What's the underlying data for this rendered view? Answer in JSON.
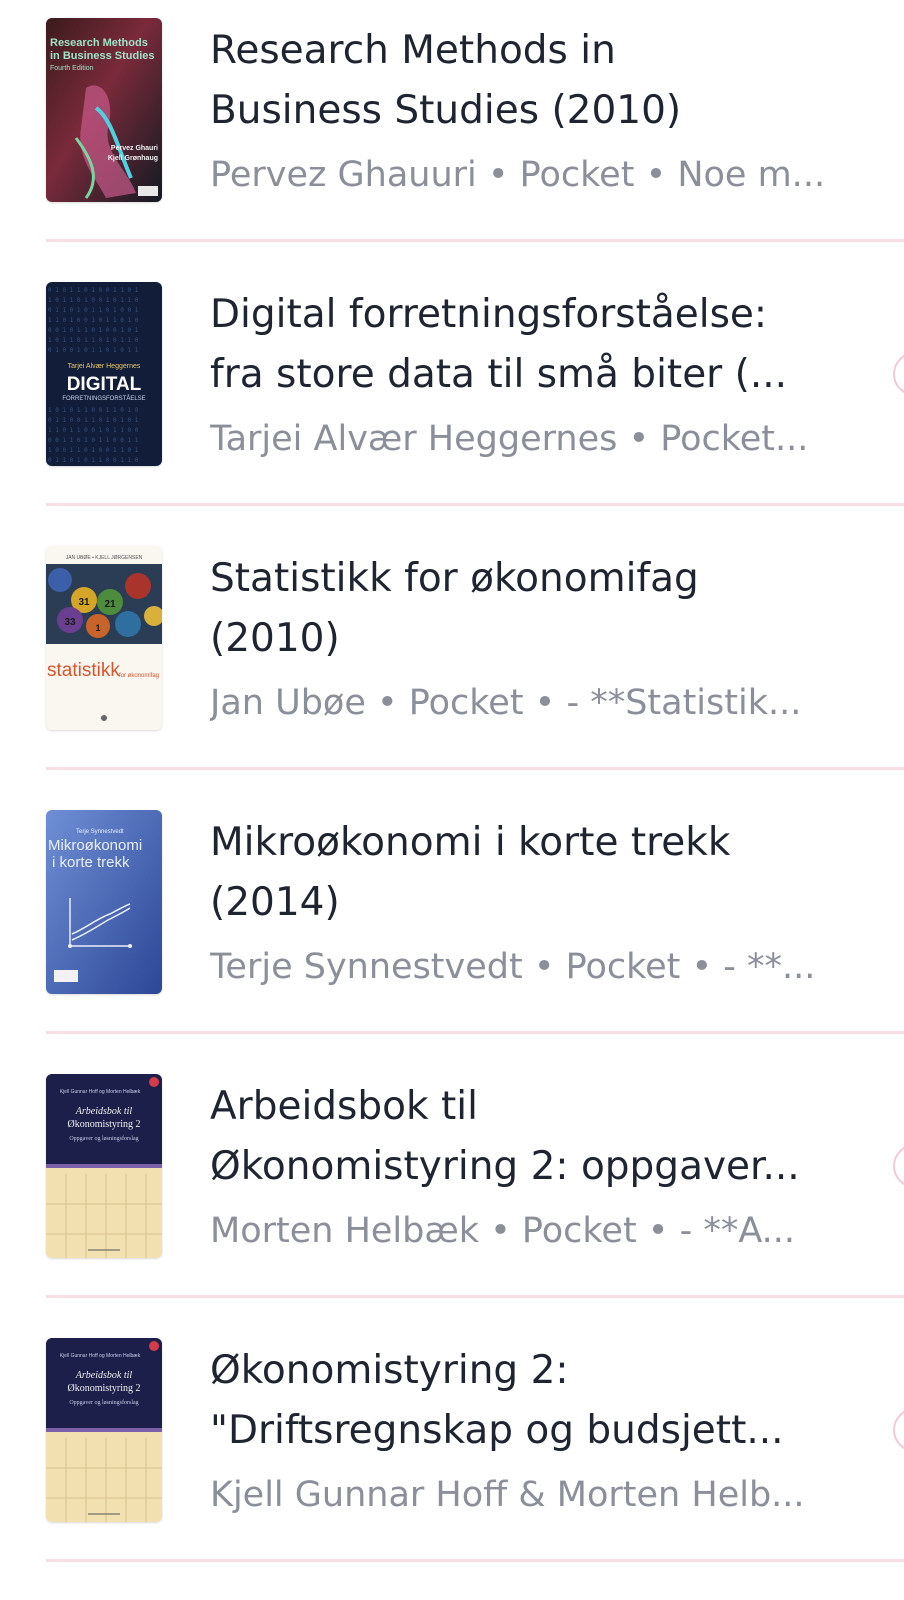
{
  "books": [
    {
      "title_line1": "Research Methods in",
      "title_line2": "Business Studies (2010)",
      "meta": "Pervez Ghauuri • Pocket • Noe m...",
      "cover": {
        "lines": [
          "Research Methods",
          "in Business Studies",
          "Fourth Edition"
        ],
        "authors": [
          "Pervez Ghauri",
          "Kjell Grønhaug"
        ]
      }
    },
    {
      "title_line1": "Digital forretningsforståelse:",
      "title_line2": "fra store data til små biter (...",
      "meta": "Tarjei Alvær Heggernes • Pocket...",
      "cover": {
        "author": "Tarjei Alvær Heggernes",
        "word": "DIGITAL",
        "subtitle": "FORRETNINGSFORSTÅELSE"
      }
    },
    {
      "title_line1": "Statistikk for økonomifag",
      "title_line2": "(2010)",
      "meta": "Jan Ubøe • Pocket • - **Statistik...",
      "cover": {
        "authors_line": "JAN UBØE • KJELL JØRGENSEN",
        "word": "statistikk",
        "small": "for økonomifag",
        "balls": [
          "31",
          "21",
          "33",
          "1"
        ]
      }
    },
    {
      "title_line1": "Mikroøkonomi i korte trekk",
      "title_line2": "(2014)",
      "meta": "Terje Synnestvedt • Pocket • - **...",
      "cover": {
        "author": "Terje Synnestvedt",
        "line1": "Mikroøkonomi",
        "line2": "i korte trekk"
      }
    },
    {
      "title_line1": "Arbeidsbok til",
      "title_line2": "Økonomistyring 2: oppgaver...",
      "meta": "Morten Helbæk • Pocket • - **A...",
      "cover": {
        "authors": "Kjell Gunnar Hoff og Morten Helbæk",
        "line1": "Arbeidsbok til",
        "line2": "Økonomistyring 2",
        "line3": "Oppgaver og løsningsforslag"
      }
    },
    {
      "title_line1": "Økonomistyring 2:",
      "title_line2": "\"Driftsregnskap og budsjett...",
      "meta": "Kjell Gunnar Hoff & Morten Helb...",
      "cover": {
        "authors": "Kjell Gunnar Hoff og Morten Helbæk",
        "line1": "Arbeidsbok til",
        "line2": "Økonomistyring 2",
        "line3": "Oppgaver og løsningsforslag"
      }
    }
  ],
  "colors": {
    "title": "#1f2530",
    "meta": "#8a8f99",
    "divider": "#f8dde5",
    "accent": "#f3c9d4"
  }
}
